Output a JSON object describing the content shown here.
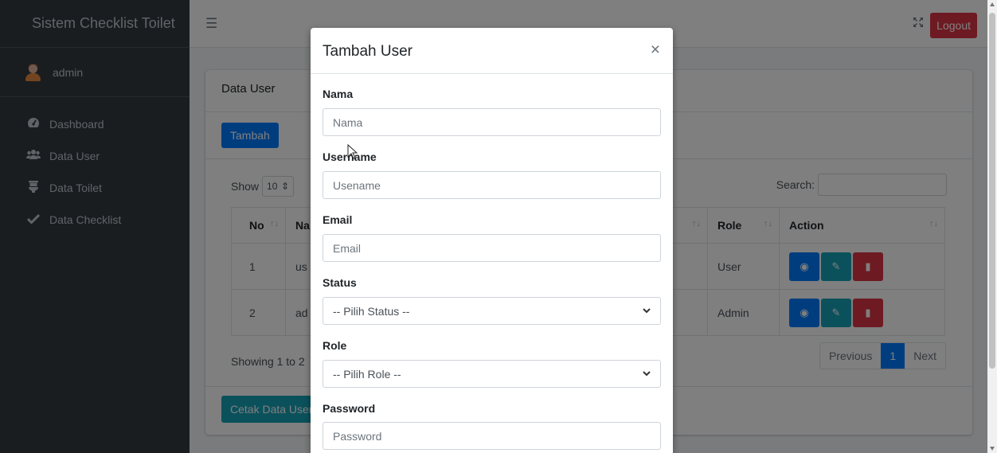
{
  "sidebar": {
    "brand": "Sistem Checklist Toilet",
    "user": "admin",
    "items": [
      {
        "label": "Dashboard",
        "icon": "tachometer-icon"
      },
      {
        "label": "Data User",
        "icon": "users-icon"
      },
      {
        "label": "Data Toilet",
        "icon": "toilet-icon"
      },
      {
        "label": "Data Checklist",
        "icon": "check-icon"
      }
    ]
  },
  "topbar": {
    "menu_icon": "☰",
    "expand_icon": "⤧",
    "logout_label": "Logout"
  },
  "card": {
    "title": "Data User",
    "add_label": "Tambah",
    "show_label": "Show",
    "show_value": "10",
    "search_label": "Search:",
    "columns": {
      "no": "No",
      "name": "Na",
      "role": "Role",
      "action": "Action"
    },
    "rows": [
      {
        "no": "1",
        "name": "us",
        "role": "User"
      },
      {
        "no": "2",
        "name": "ad",
        "role": "Admin"
      }
    ],
    "info": "Showing 1 to 2",
    "pagination": {
      "previous": "Previous",
      "current": "1",
      "next": "Next"
    },
    "print_label": "Cetak Data User"
  },
  "modal": {
    "title": "Tambah User",
    "close": "×",
    "fields": {
      "nama_label": "Nama",
      "nama_placeholder": "Nama",
      "username_label": "Username",
      "username_placeholder": "Usename",
      "email_label": "Email",
      "email_placeholder": "Email",
      "status_label": "Status",
      "status_value": "-- Pilih Status --",
      "role_label": "Role",
      "role_value": "-- Pilih Role --",
      "password_label": "Password",
      "password_placeholder": "Password"
    }
  },
  "colors": {
    "sidebar": "#343a40",
    "primary": "#007bff",
    "info": "#17a2b8",
    "danger": "#dc3545"
  }
}
